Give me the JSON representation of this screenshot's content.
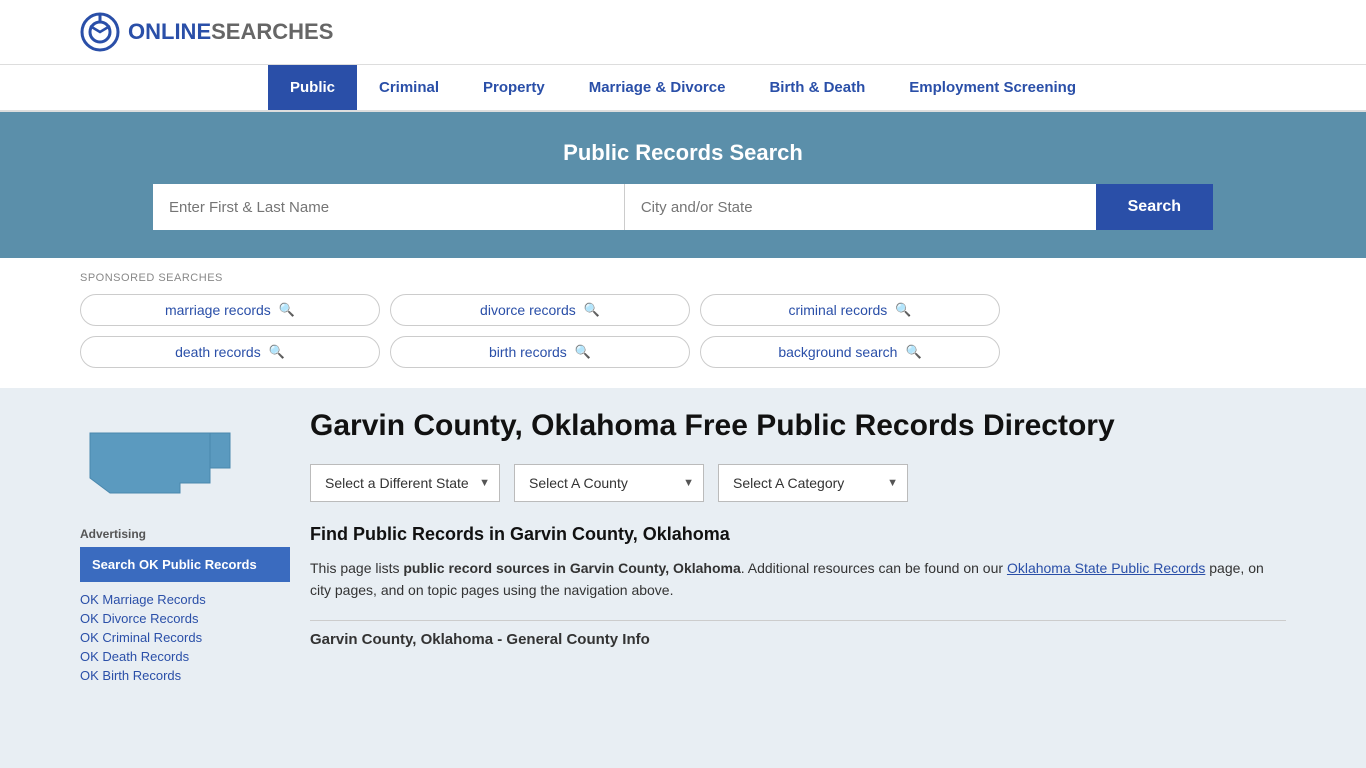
{
  "header": {
    "logo_text_online": "ONLINE",
    "logo_text_searches": "SEARCHES"
  },
  "nav": {
    "items": [
      {
        "label": "Public",
        "active": true
      },
      {
        "label": "Criminal",
        "active": false
      },
      {
        "label": "Property",
        "active": false
      },
      {
        "label": "Marriage & Divorce",
        "active": false
      },
      {
        "label": "Birth & Death",
        "active": false
      },
      {
        "label": "Employment Screening",
        "active": false
      }
    ]
  },
  "hero": {
    "title": "Public Records Search",
    "name_placeholder": "Enter First & Last Name",
    "city_placeholder": "City and/or State",
    "search_button": "Search"
  },
  "sponsored": {
    "label": "SPONSORED SEARCHES",
    "tags": [
      "marriage records",
      "divorce records",
      "criminal records",
      "death records",
      "birth records",
      "background search"
    ]
  },
  "page": {
    "title": "Garvin County, Oklahoma Free Public Records Directory",
    "dropdowns": {
      "state": "Select a Different State",
      "county": "Select A County",
      "category": "Select A Category"
    },
    "find_heading": "Find Public Records in Garvin County, Oklahoma",
    "find_text_1": "This page lists ",
    "find_text_bold": "public record sources in Garvin County, Oklahoma",
    "find_text_2": ". Additional resources can be found on our ",
    "find_link": "Oklahoma State Public Records",
    "find_text_3": " page, on city pages, and on topic pages using the navigation above.",
    "county_info_heading": "Garvin County, Oklahoma - General County Info"
  },
  "sidebar": {
    "advertising_label": "Advertising",
    "ad_box_text": "Search OK Public Records",
    "links": [
      "OK Marriage Records",
      "OK Divorce Records",
      "OK Criminal Records",
      "OK Death Records",
      "OK Birth Records"
    ]
  }
}
